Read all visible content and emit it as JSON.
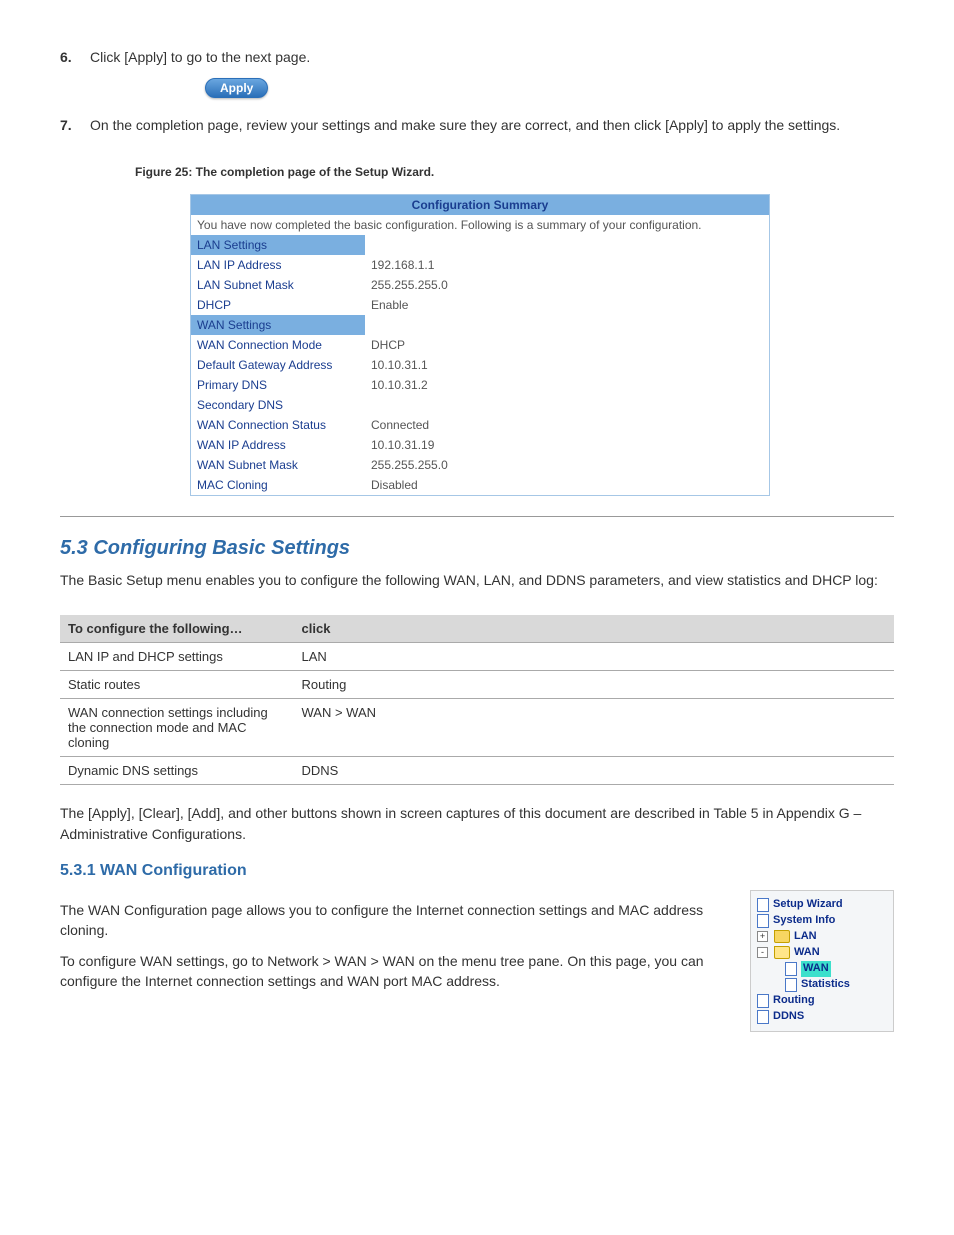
{
  "steps": {
    "s6": {
      "num": "6.",
      "text": "Click [Apply] to go to the next page."
    },
    "s7": {
      "num": "7.",
      "text": "On the completion page, review your settings and make sure they are correct, and then click [Apply] to apply the settings."
    }
  },
  "apply_label": "Apply",
  "fig_caption": "Figure 25: The completion page of the Setup Wizard.",
  "summary": {
    "title": "Configuration Summary",
    "intro": "You have now completed the basic configuration. Following is a summary of your configuration.",
    "lan_section": "LAN Settings",
    "lan_ip_lbl": "LAN IP Address",
    "lan_ip_val": "192.168.1.1",
    "lan_mask_lbl": "LAN Subnet Mask",
    "lan_mask_val": "255.255.255.0",
    "dhcp_lbl": "DHCP",
    "dhcp_val": "Enable",
    "wan_section": "WAN Settings",
    "wan_mode_lbl": "WAN Connection Mode",
    "wan_mode_val": "DHCP",
    "gateway_lbl": "Default Gateway Address",
    "gateway_val": "10.10.31.1",
    "pdns_lbl": "Primary DNS",
    "pdns_val": "10.10.31.2",
    "sdns_lbl": "Secondary DNS",
    "sdns_val": "",
    "wan_status_lbl": "WAN Connection Status",
    "wan_status_val": "Connected",
    "wan_ip_lbl": "WAN IP Address",
    "wan_ip_val": "10.10.31.19",
    "wan_mask_lbl": "WAN Subnet Mask",
    "wan_mask_val": "255.255.255.0",
    "mac_lbl": "MAC Cloning",
    "mac_val": "Disabled"
  },
  "section_heading": "5.3 Configuring Basic Settings",
  "section_intro": "The Basic Setup menu enables you to configure the following WAN, LAN, and DDNS parameters, and view statistics and DHCP log:",
  "action_table": {
    "head1": "To configure the following…",
    "head2": "click",
    "r1a": "LAN IP and DHCP settings",
    "r1b": "LAN",
    "r2a": "Static routes",
    "r2b": "Routing",
    "r3a": "WAN connection settings including the connection mode and MAC cloning",
    "r3b": "WAN > WAN",
    "r4a": "Dynamic DNS settings",
    "r4b": "DDNS"
  },
  "paragraphs": {
    "p_btn_note": "The [Apply], [Clear], [Add], and other buttons shown in screen captures of this document are described in Table 5 in Appendix G – Administrative Configurations.",
    "p_wan1": "The WAN Configuration page allows you to configure the Internet connection settings and MAC address cloning.",
    "p_wan2": "To configure WAN settings, go to Network > WAN > WAN on the menu tree pane. On this page, you can configure the Internet connection settings and WAN port MAC address."
  },
  "subsection_heading": "5.3.1 WAN Configuration",
  "tree": {
    "setup": "Setup Wizard",
    "sysinfo": "System Info",
    "lan": "LAN",
    "wan": "WAN",
    "wan_sub": "WAN",
    "stats": "Statistics",
    "routing": "Routing",
    "ddns": "DDNS"
  }
}
